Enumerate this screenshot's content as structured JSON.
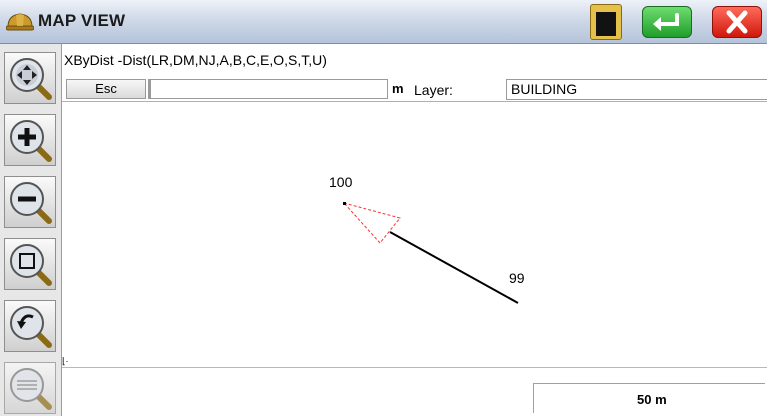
{
  "title": "MAP VIEW",
  "command": {
    "prompt": "XByDist -Dist(LR,DM,NJ,A,B,C,E,O,S,T,U)",
    "esc_label": "Esc",
    "input_value": "",
    "unit": "m",
    "layer_label": "Layer:",
    "layer_value": "BUILDING"
  },
  "map": {
    "points": [
      {
        "label": "100"
      },
      {
        "label": "99"
      }
    ]
  },
  "status": {
    "scale": "50 m"
  },
  "toolbar": {
    "tools": [
      "pan-icon",
      "zoom-in-icon",
      "zoom-out-icon",
      "zoom-window-icon",
      "zoom-previous-icon",
      "zoom-extents-icon"
    ]
  },
  "colors": {
    "accent_green": "#2aa832",
    "accent_red": "#e0211a",
    "triangle_red": "#ff3030"
  }
}
